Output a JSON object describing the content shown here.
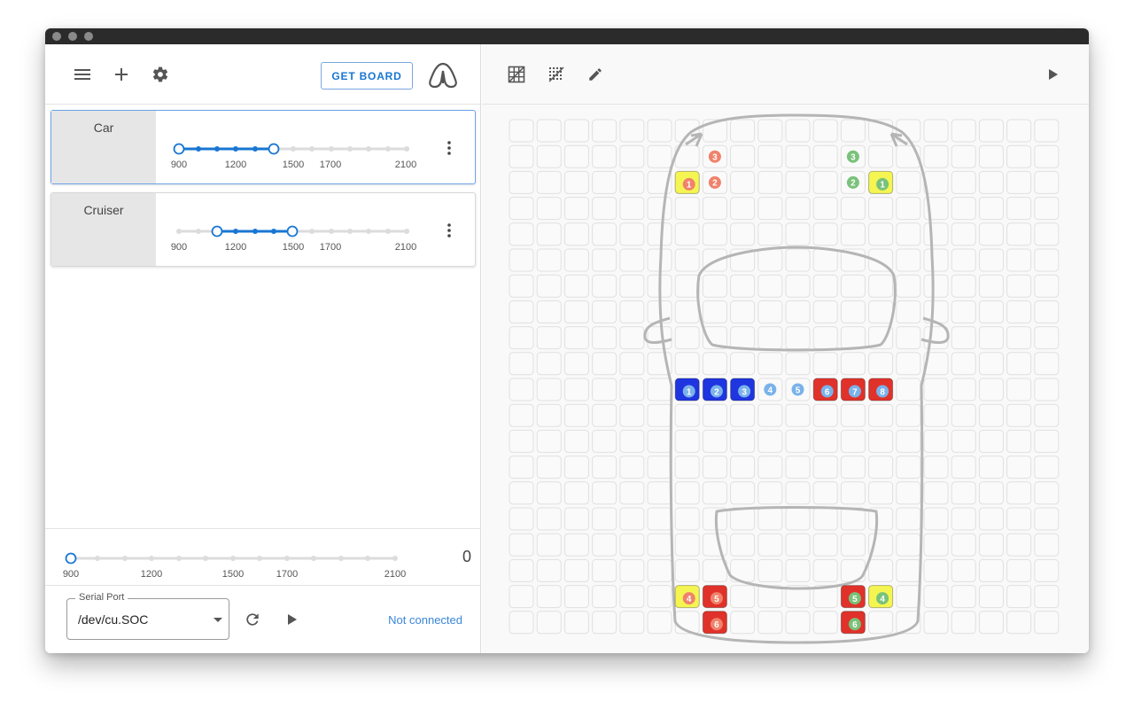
{
  "toolbar": {
    "get_board_label": "GET BOARD",
    "icons": [
      "menu-icon",
      "add-icon",
      "settings-icon",
      "logo-icon"
    ]
  },
  "profiles": [
    {
      "name": "Car",
      "selected": true,
      "ticks": [
        "900",
        "1200",
        "1500",
        "1700",
        "2100"
      ],
      "range": [
        900,
        1500
      ]
    },
    {
      "name": "Cruiser",
      "selected": false,
      "ticks": [
        "900",
        "1200",
        "1500",
        "1700",
        "2100"
      ],
      "range": [
        1100,
        1500
      ]
    }
  ],
  "global_slider": {
    "ticks": [
      "900",
      "1200",
      "1500",
      "1700",
      "2100"
    ],
    "value_display": "0"
  },
  "serial": {
    "legend": "Serial Port",
    "port": "/dev/cu.SOC",
    "status": "Not connected"
  },
  "right_toolbar": {
    "icons": [
      "grid-icon",
      "grid-dots-icon",
      "pencil-icon",
      "play-icon"
    ]
  },
  "colors": {
    "accent": "#1976d2",
    "yellow": "#f5f552",
    "red": "#e0322a",
    "blue": "#1e35e0",
    "num_orange": "#f0826b",
    "num_green": "#79c27a",
    "num_blue": "#7ab2ea"
  },
  "board": {
    "cells": [
      {
        "row": 1,
        "col": 7,
        "n": "3",
        "fill": "none",
        "numc": "orange"
      },
      {
        "row": 2,
        "col": 6,
        "n": "1",
        "fill": "yellow",
        "numc": "orange"
      },
      {
        "row": 2,
        "col": 7,
        "n": "2",
        "fill": "none",
        "numc": "orange"
      },
      {
        "row": 1,
        "col": 12,
        "n": "3",
        "fill": "none",
        "numc": "green"
      },
      {
        "row": 2,
        "col": 12,
        "n": "2",
        "fill": "none",
        "numc": "green"
      },
      {
        "row": 2,
        "col": 13,
        "n": "1",
        "fill": "yellow",
        "numc": "green"
      },
      {
        "row": 10,
        "col": 6,
        "n": "1",
        "fill": "blue",
        "numc": "blue"
      },
      {
        "row": 10,
        "col": 7,
        "n": "2",
        "fill": "blue",
        "numc": "blue"
      },
      {
        "row": 10,
        "col": 8,
        "n": "3",
        "fill": "blue",
        "numc": "blue"
      },
      {
        "row": 10,
        "col": 9,
        "n": "4",
        "fill": "none",
        "numc": "blue"
      },
      {
        "row": 10,
        "col": 10,
        "n": "5",
        "fill": "none",
        "numc": "blue"
      },
      {
        "row": 10,
        "col": 11,
        "n": "6",
        "fill": "red",
        "numc": "blue"
      },
      {
        "row": 10,
        "col": 12,
        "n": "7",
        "fill": "red",
        "numc": "blue"
      },
      {
        "row": 10,
        "col": 13,
        "n": "8",
        "fill": "red",
        "numc": "blue"
      },
      {
        "row": 18,
        "col": 6,
        "n": "4",
        "fill": "yellow",
        "numc": "orange"
      },
      {
        "row": 18,
        "col": 7,
        "n": "5",
        "fill": "red",
        "numc": "orange"
      },
      {
        "row": 19,
        "col": 7,
        "n": "6",
        "fill": "red",
        "numc": "orange"
      },
      {
        "row": 18,
        "col": 12,
        "n": "5",
        "fill": "red",
        "numc": "green"
      },
      {
        "row": 18,
        "col": 13,
        "n": "4",
        "fill": "yellow",
        "numc": "green"
      },
      {
        "row": 19,
        "col": 12,
        "n": "6",
        "fill": "red",
        "numc": "green"
      }
    ]
  }
}
